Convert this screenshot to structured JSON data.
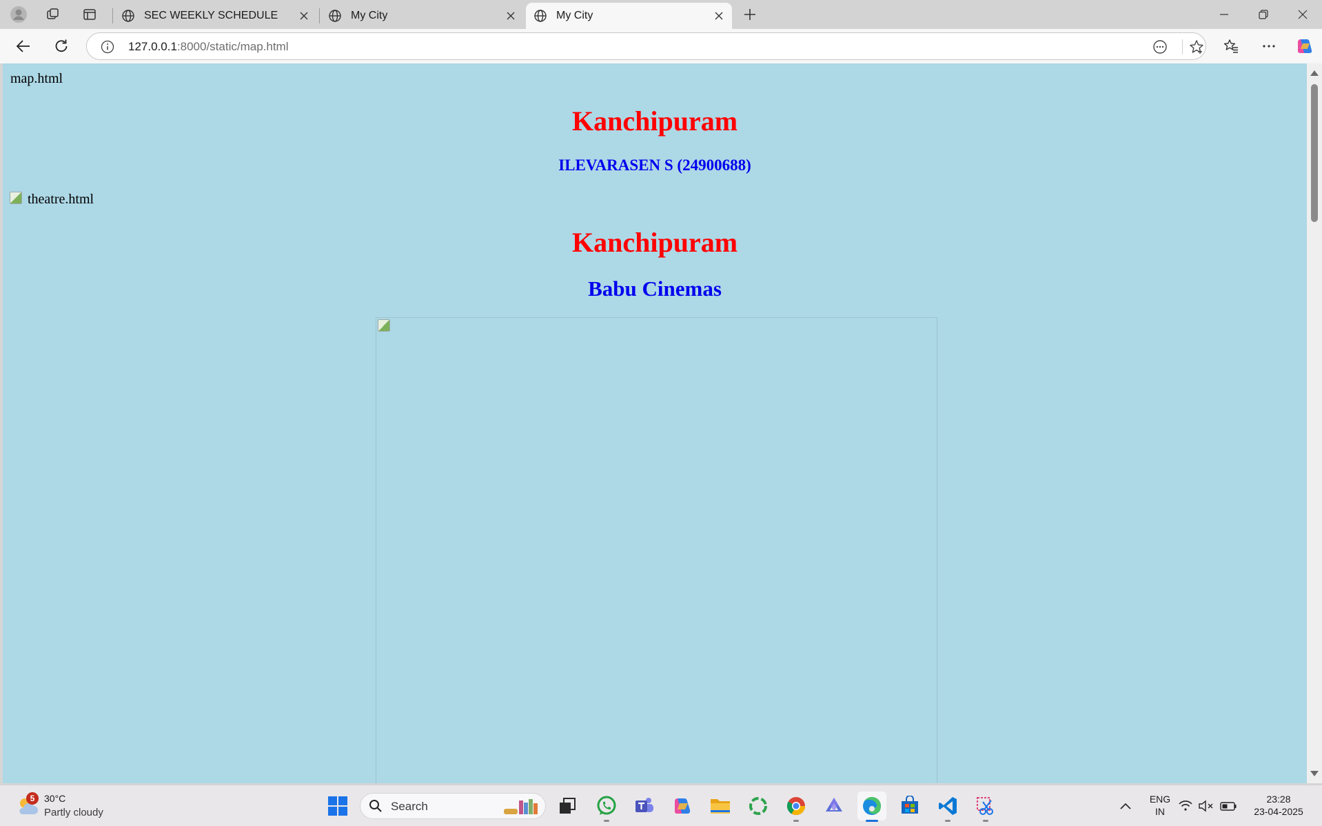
{
  "browser": {
    "tabs": [
      {
        "title": "SEC WEEKLY SCHEDULE",
        "active": false
      },
      {
        "title": "My City",
        "active": false
      },
      {
        "title": "My City",
        "active": true
      }
    ],
    "address": {
      "host": "127.0.0.1",
      "rest": ":8000/static/map.html"
    }
  },
  "page": {
    "background": "#add8e6",
    "map_label": "map.html",
    "section1": {
      "title": "Kanchipuram",
      "subtitle": "ILEVARASEN S (24900688)"
    },
    "theatre_alt": "theatre.html",
    "section2": {
      "title": "Kanchipuram",
      "subtitle": "Babu Cinemas"
    }
  },
  "taskbar": {
    "weather": {
      "temp": "30°C",
      "condition": "Partly cloudy",
      "badge": "5"
    },
    "search_label": "Search",
    "apps": [
      "whatsapp-icon",
      "teams-icon",
      "copilot-icon",
      "file-explorer-icon",
      "app-green-icon",
      "chrome-icon",
      "proton-icon",
      "edge-icon",
      "store-icon",
      "vscode-icon",
      "snipping-tool-icon"
    ],
    "lang_top": "ENG",
    "lang_bottom": "IN",
    "time": "23:28",
    "date": "23-04-2025"
  },
  "colors": {
    "heading_red": "#ff0000",
    "heading_blue": "#0000ee",
    "accent": "#1a6fd8"
  }
}
